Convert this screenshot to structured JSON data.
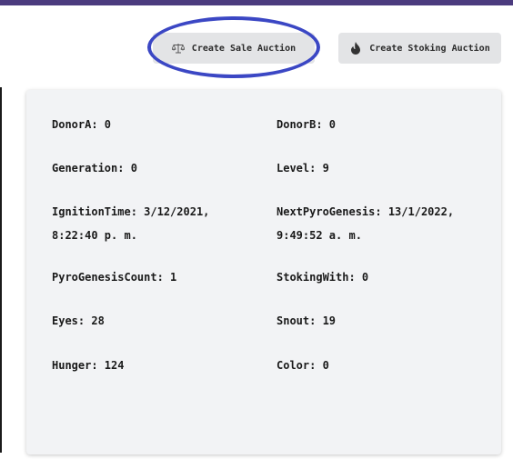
{
  "toolbar": {
    "sale_label": "Create Sale Auction",
    "stoking_label": "Create Stoking Auction",
    "sale_icon": "scale-icon",
    "stoking_icon": "fire-icon"
  },
  "colors": {
    "accent_bar": "#4b3b7e",
    "highlight_ring": "#3b47c4",
    "card_bg": "#f2f3f5",
    "button_bg": "#e3e4e6"
  },
  "details": {
    "donor_a": "DonorA: 0",
    "donor_b": "DonorB: 0",
    "generation": "Generation: 0",
    "level": "Level: 9",
    "ignition_time_line1": "IgnitionTime: 3/12/2021,",
    "ignition_time_line2": "8:22:40 p. m.",
    "next_pyrogenesis_line1": "NextPyroGenesis: 13/1/2022,",
    "next_pyrogenesis_line2": "9:49:52 a. m.",
    "pyrogenesis_count": "PyroGenesisCount: 1",
    "stoking_with": "StokingWith: 0",
    "eyes": "Eyes: 28",
    "snout": "Snout: 19",
    "hunger": "Hunger: 124",
    "color": "Color: 0"
  }
}
